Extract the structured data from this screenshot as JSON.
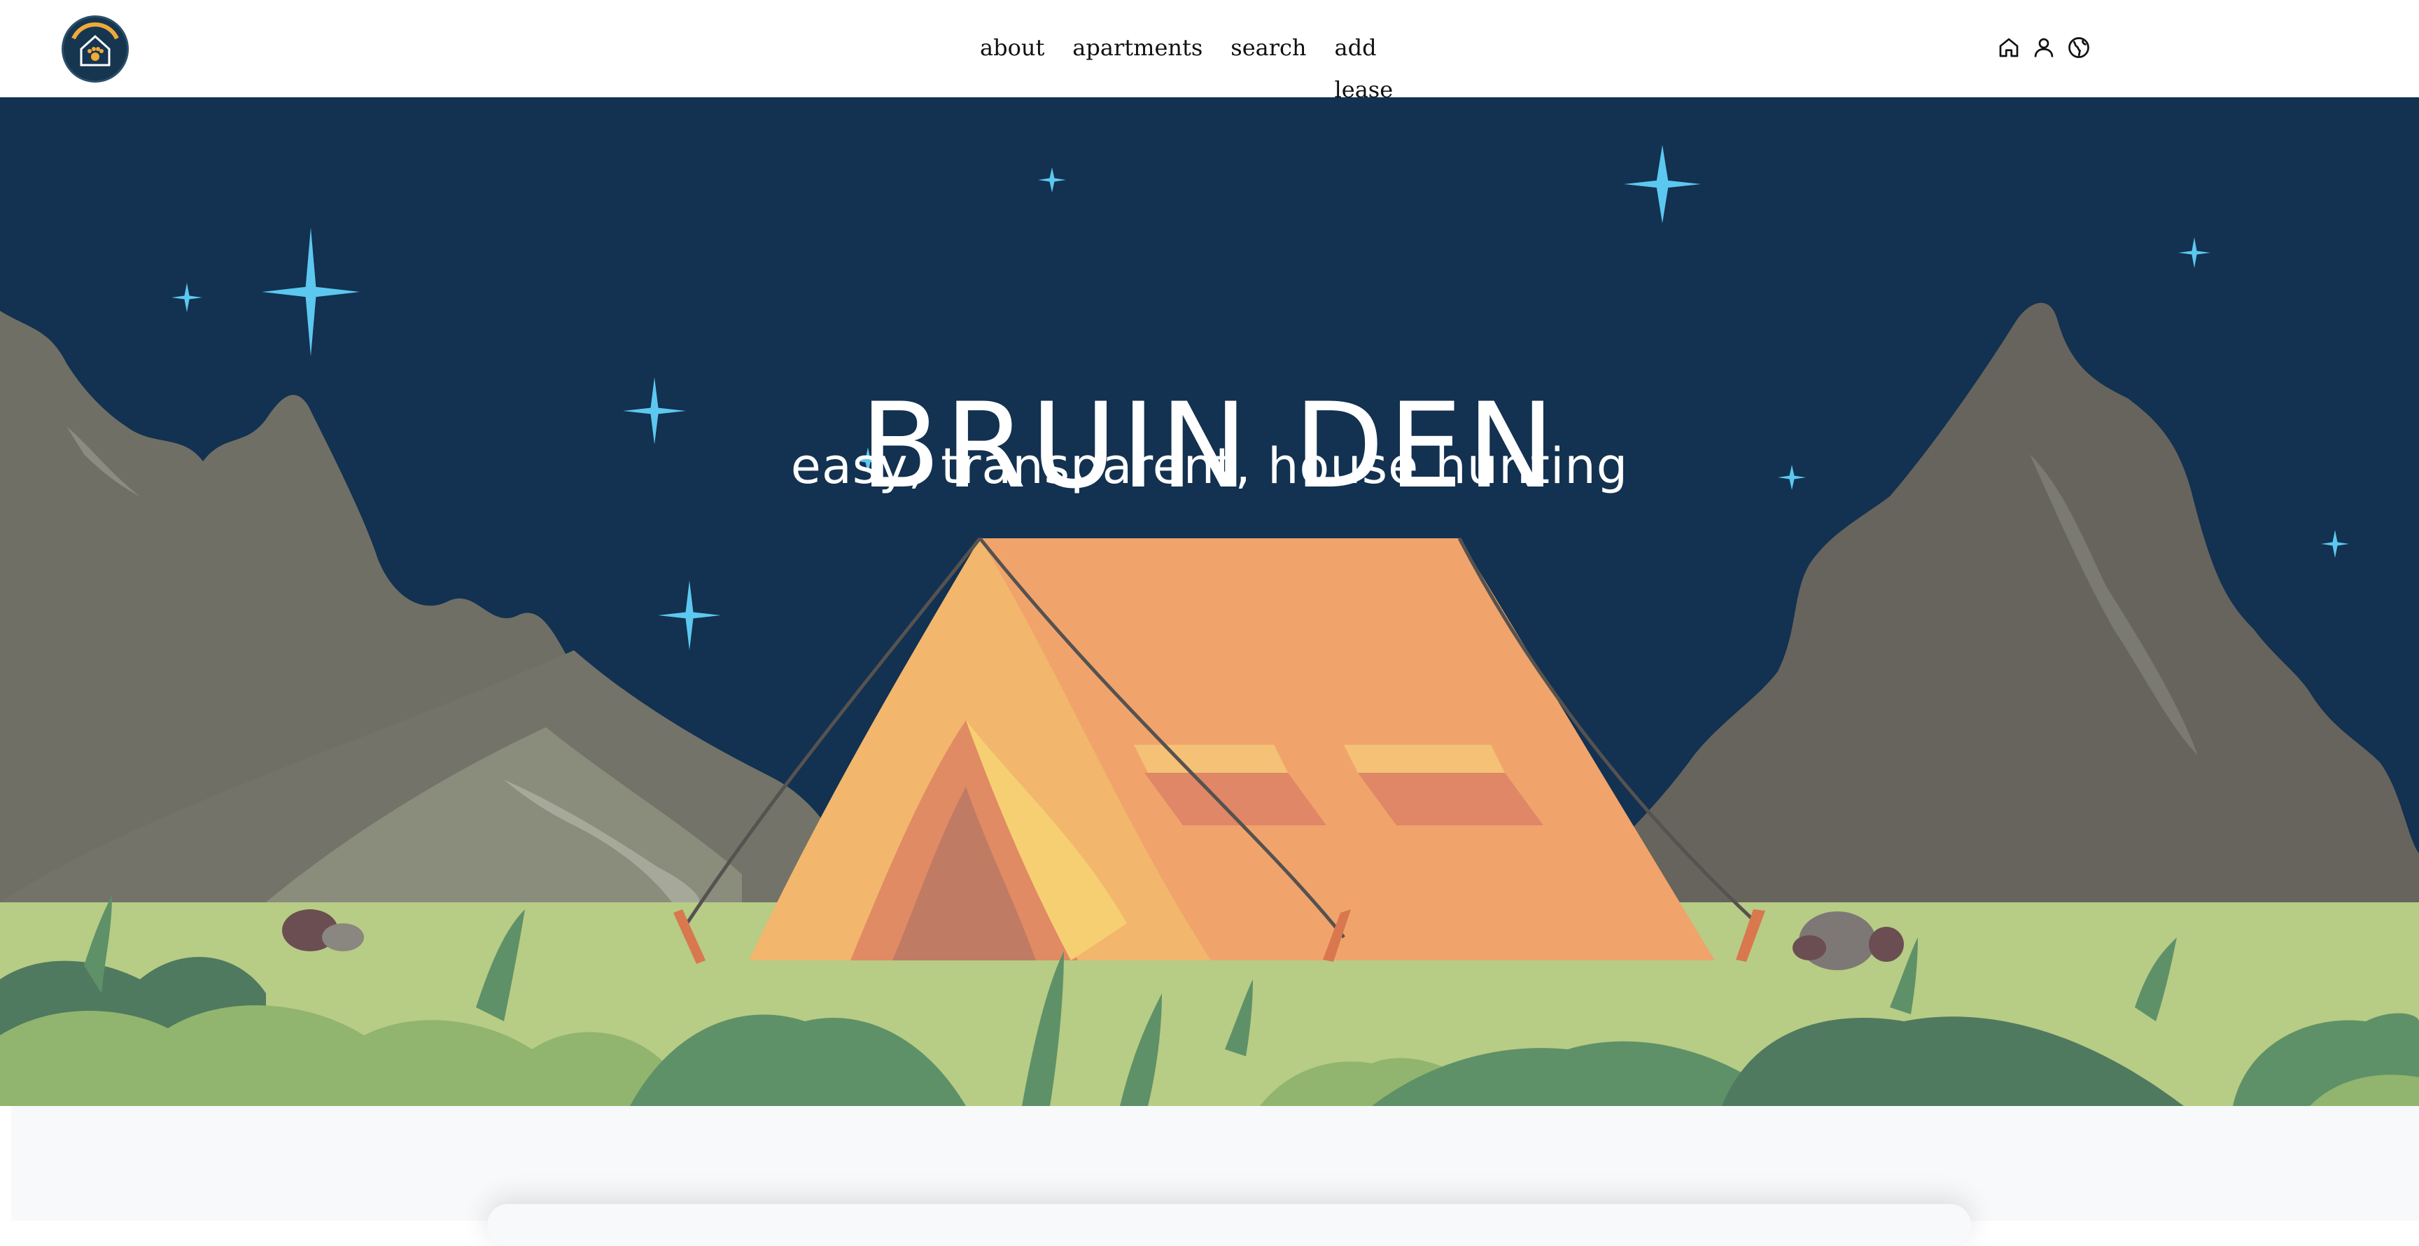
{
  "brand": {
    "logo_text": "BRUIN DEN",
    "colors": {
      "logo_bg": "#163650",
      "logo_accent": "#f0a93a"
    }
  },
  "nav": {
    "links": [
      {
        "label": "about"
      },
      {
        "label": "apartments"
      },
      {
        "label": "search"
      },
      {
        "label": "add lease"
      }
    ],
    "icons": [
      "home-icon",
      "user-icon",
      "globe-icon"
    ]
  },
  "hero": {
    "title": "BRUIN DEN",
    "subtitle": "easy, transparent, house hunting",
    "colors": {
      "sky": "#133150",
      "mountain": "#6e6e66",
      "grass": "#b7cc85",
      "tent": "#f0a46b",
      "tent_light": "#f2b66d",
      "star": "#5cc8f0"
    }
  }
}
